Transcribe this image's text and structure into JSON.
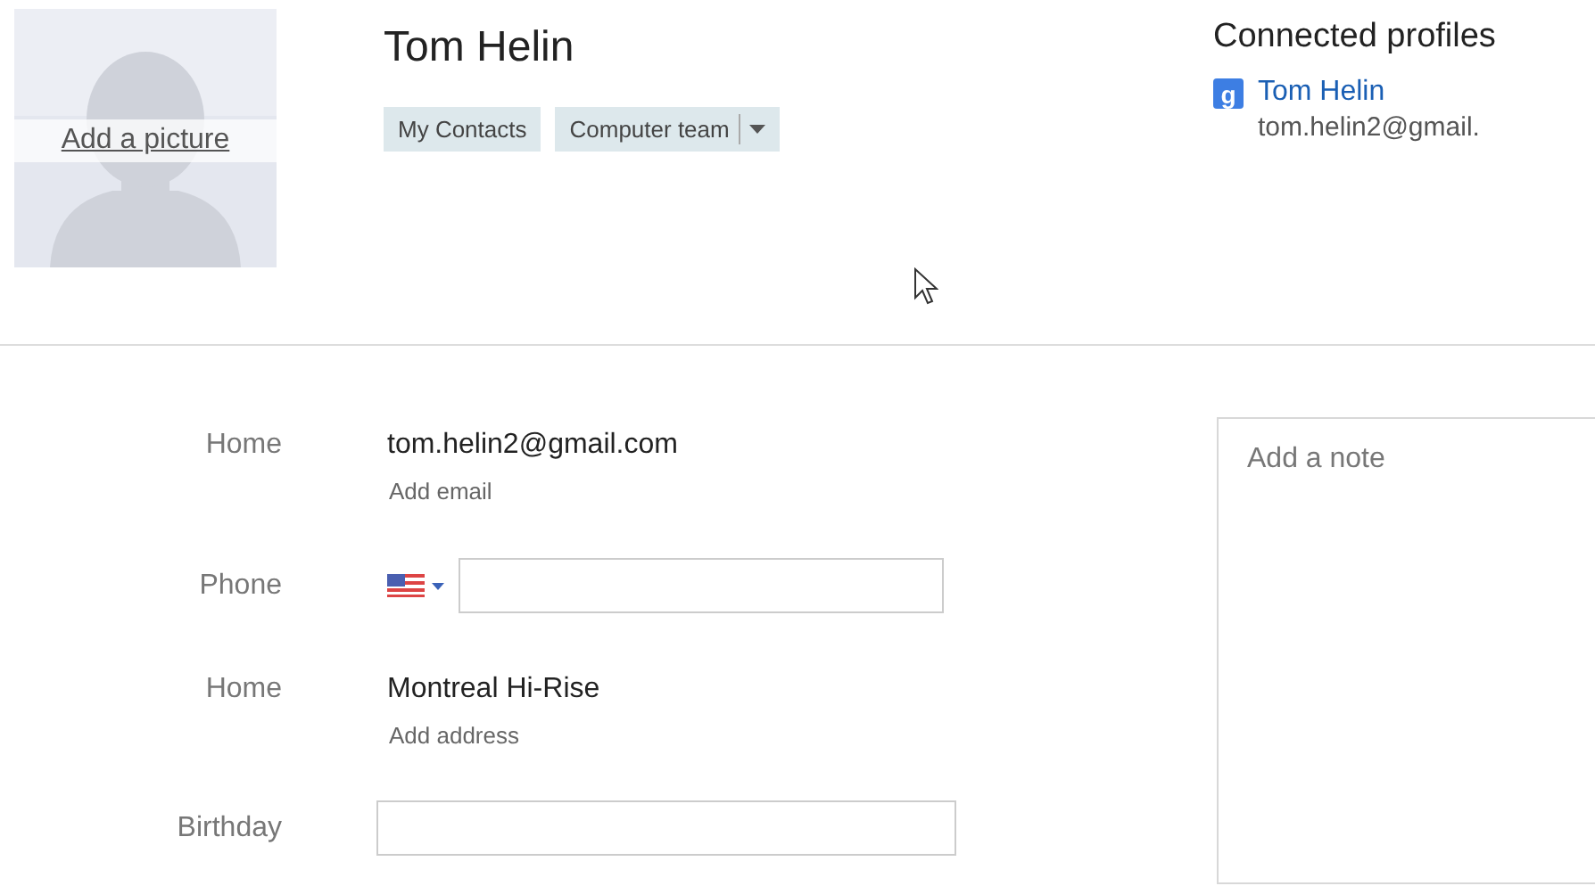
{
  "photo": {
    "action": "Add a picture"
  },
  "name": "Tom Helin",
  "groups": [
    {
      "label": "My Contacts",
      "kind": "chip"
    },
    {
      "label": "Computer team",
      "kind": "dropdown"
    }
  ],
  "connected": {
    "title": "Connected profiles",
    "profiles": [
      {
        "service_glyph": "g",
        "name": "Tom Helin",
        "email": "tom.helin2@gmail."
      }
    ]
  },
  "fields": [
    {
      "kind": "text",
      "label": "Home",
      "value": "tom.helin2@gmail.com",
      "add_link": "Add email"
    },
    {
      "kind": "phone",
      "label": "Phone"
    },
    {
      "kind": "text",
      "label": "Home",
      "value": "Montreal Hi-Rise",
      "add_link": "Add address"
    },
    {
      "kind": "input",
      "label": "Birthday"
    }
  ],
  "note": {
    "placeholder": "Add a note"
  }
}
